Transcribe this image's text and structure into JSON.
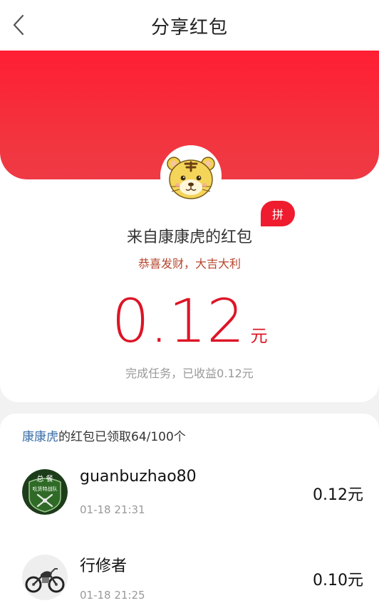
{
  "header": {
    "title": "分享红包"
  },
  "packet": {
    "from_text": "来自康康虎的红包",
    "badge_text": "拼",
    "blessing": "恭喜发财，大吉大利",
    "amount": "0.12",
    "unit": "元",
    "income_text": "完成任务，已收益0.12元"
  },
  "list": {
    "owner": "康康虎",
    "summary_suffix": "的红包已领取64/100个",
    "items": [
      {
        "name": "guanbuzhao80",
        "time": "01-18 21:31",
        "amount": "0.12元",
        "avatar_badge_top": "总 餐",
        "avatar_badge_mid": "吃货特战队"
      },
      {
        "name": "行修者",
        "time": "01-18 21:25",
        "amount": "0.10元"
      }
    ]
  },
  "colors": {
    "red": "#ff1e33",
    "amount_red": "#dd1526",
    "blessing": "#b6452d",
    "owner_link": "#3a6ea8"
  }
}
